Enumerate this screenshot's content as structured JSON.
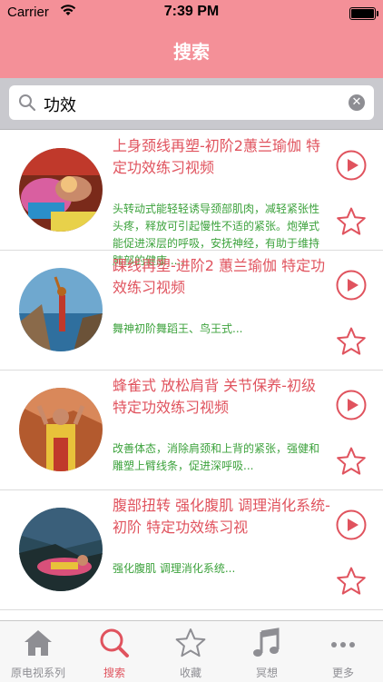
{
  "status": {
    "carrier": "Carrier",
    "time": "7:39 PM"
  },
  "nav": {
    "title": "搜索"
  },
  "search": {
    "query": "功效"
  },
  "items": [
    {
      "title": "上身颈线再塑-初阶2蕙兰瑜伽 特定功效练习视频",
      "desc": "头转动式能轻轻诱导颈部肌肉，减轻紧张性头疼，释放可引起慢性不适的紧张。炮弹式能促进深层的呼吸，安抚神经，有助于维持肺部的健康....."
    },
    {
      "title": "踝线再塑-进阶2 蕙兰瑜伽 特定功效练习视频",
      "desc": "舞神初阶舞蹈王、鸟王式..."
    },
    {
      "title": "蜂雀式 放松肩背 关节保养-初级 特定功效练习视频",
      "desc": "改善体态，消除肩颈和上背的紧张，强健和雕塑上臂线条，促进深呼吸..."
    },
    {
      "title": "腹部扭转 强化腹肌 调理消化系统-初阶  特定功效练习视",
      "desc": "强化腹肌 调理消化系统..."
    }
  ],
  "tabs": [
    {
      "label": "原电视系列",
      "icon": "home-icon"
    },
    {
      "label": "搜索",
      "icon": "search-icon"
    },
    {
      "label": "收藏",
      "icon": "star-icon"
    },
    {
      "label": "冥想",
      "icon": "music-note-icon"
    },
    {
      "label": "更多",
      "icon": "more-icon"
    }
  ],
  "colors": {
    "accent": "#f49098",
    "title_red": "#e0535e",
    "desc_green": "#3ca23c"
  }
}
